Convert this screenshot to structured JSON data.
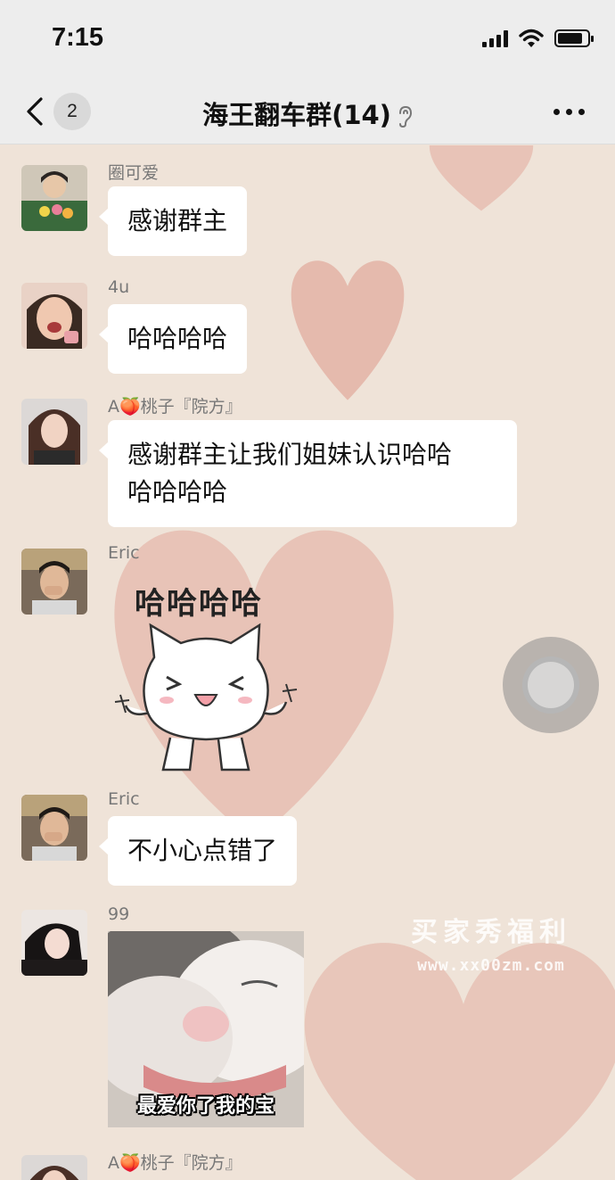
{
  "status_bar": {
    "time": "7:15",
    "icons": [
      "signal-icon",
      "wifi-icon",
      "battery-icon"
    ],
    "battery_level": 0.85
  },
  "nav": {
    "back_icon": "chevron-left-icon",
    "unread_count": "2",
    "title": "海王翻车群(14)",
    "mute_icon": "ear-icon",
    "more_icon": "more-dots-icon"
  },
  "messages": [
    {
      "sender": "圈可爱",
      "type": "text",
      "text": "感谢群主"
    },
    {
      "sender": "4u",
      "type": "text",
      "text": "哈哈哈哈"
    },
    {
      "sender": "A🍑桃子『院方』",
      "type": "text",
      "lines": [
        "感谢群主让我们姐妹认识哈哈",
        "哈哈哈哈"
      ]
    },
    {
      "sender": "Eric",
      "type": "sticker",
      "sticker_text": "哈哈哈哈",
      "sticker_icon": "laughing-cat-sticker"
    },
    {
      "sender": "Eric",
      "type": "text",
      "text": "不小心点错了"
    },
    {
      "sender": "99",
      "type": "image",
      "caption": "最爱你了我的宝",
      "image_icon": "cat-photo"
    },
    {
      "sender": "A🍑桃子『院方』",
      "type": "partial"
    }
  ],
  "floating_button": "assistive-touch-icon",
  "watermark": {
    "title": "买家秀福利",
    "url": "www.xx00zm.com"
  },
  "colors": {
    "background": "#efe3d8",
    "heart": "#e2a99c",
    "bubble": "#ffffff",
    "bar": "#ededed"
  }
}
